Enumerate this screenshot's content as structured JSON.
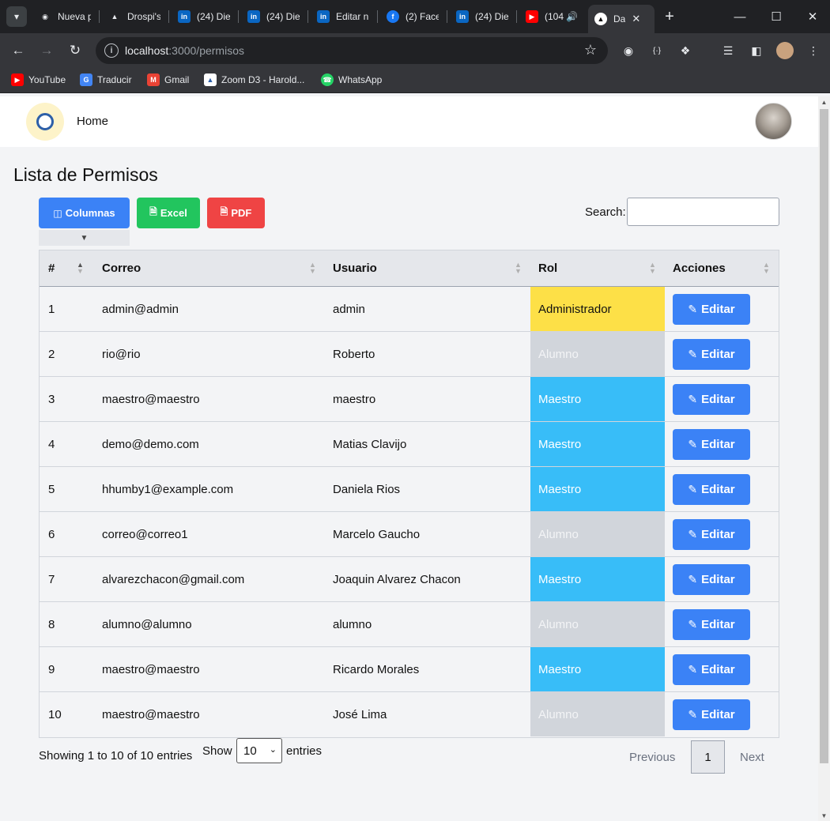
{
  "browser": {
    "tabs": [
      {
        "title": "Nueva p",
        "icon": "chrome-icon",
        "color": "#e8eaed"
      },
      {
        "title": "Drospi's",
        "icon": "vercel-icon",
        "color": "#e8eaed"
      },
      {
        "title": "(24) Die",
        "icon": "linkedin-icon",
        "color": "#0a66c2"
      },
      {
        "title": "(24) Die",
        "icon": "linkedin-icon",
        "color": "#0a66c2"
      },
      {
        "title": "Editar n",
        "icon": "linkedin-icon",
        "color": "#0a66c2"
      },
      {
        "title": "(2) Face",
        "icon": "facebook-icon",
        "color": "#1877f2"
      },
      {
        "title": "(24) Die",
        "icon": "linkedin-icon",
        "color": "#0a66c2"
      },
      {
        "title": "(104",
        "icon": "youtube-icon",
        "color": "#ff0000"
      }
    ],
    "active_tab": {
      "title": "Da",
      "icon": "nextjs-icon"
    },
    "url_host": "localhost",
    "url_path": ":3000/permisos",
    "bookmarks": [
      {
        "label": "YouTube",
        "icon": "youtube-icon",
        "color": "#ff0000"
      },
      {
        "label": "Traducir",
        "icon": "google-translate-icon",
        "color": "#4285f4"
      },
      {
        "label": "Gmail",
        "icon": "gmail-icon",
        "color": "#ea4335"
      },
      {
        "label": "Zoom D3 - Harold...",
        "icon": "page-icon",
        "color": "#ffffff"
      },
      {
        "label": "WhatsApp",
        "icon": "whatsapp-icon",
        "color": "#25d366"
      }
    ]
  },
  "nav": {
    "home_label": "Home"
  },
  "page": {
    "title": "Lista de Permisos",
    "buttons": {
      "columns": "Columnas",
      "excel": "Excel",
      "pdf": "PDF"
    },
    "search_label": "Search:",
    "search_value": ""
  },
  "table": {
    "headers": [
      "#",
      "Correo",
      "Usuario",
      "Rol",
      "Acciones"
    ],
    "edit_label": "Editar",
    "rows": [
      {
        "id": "1",
        "correo": "admin@admin",
        "usuario": "admin",
        "rol": "Administrador",
        "rol_type": "admin"
      },
      {
        "id": "2",
        "correo": "rio@rio",
        "usuario": "Roberto",
        "rol": "Alumno",
        "rol_type": "alumno"
      },
      {
        "id": "3",
        "correo": "maestro@maestro",
        "usuario": "maestro",
        "rol": "Maestro",
        "rol_type": "maestro"
      },
      {
        "id": "4",
        "correo": "demo@demo.com",
        "usuario": "Matias Clavijo",
        "rol": "Maestro",
        "rol_type": "maestro"
      },
      {
        "id": "5",
        "correo": "hhumby1@example.com",
        "usuario": "Daniela Rios",
        "rol": "Maestro",
        "rol_type": "maestro"
      },
      {
        "id": "6",
        "correo": "correo@correo1",
        "usuario": "Marcelo Gaucho",
        "rol": "Alumno",
        "rol_type": "alumno"
      },
      {
        "id": "7",
        "correo": "alvarezchacon@gmail.com",
        "usuario": "Joaquin Alvarez Chacon",
        "rol": "Maestro",
        "rol_type": "maestro"
      },
      {
        "id": "8",
        "correo": "alumno@alumno",
        "usuario": "alumno",
        "rol": "Alumno",
        "rol_type": "alumno"
      },
      {
        "id": "9",
        "correo": "maestro@maestro",
        "usuario": "Ricardo Morales",
        "rol": "Maestro",
        "rol_type": "maestro"
      },
      {
        "id": "10",
        "correo": "maestro@maestro",
        "usuario": "José Lima",
        "rol": "Alumno",
        "rol_type": "alumno"
      }
    ]
  },
  "footer": {
    "info": "Showing 1 to 10 of 10 entries",
    "show_label": "Show",
    "page_length": "10",
    "entries_label": "entries",
    "previous": "Previous",
    "current_page": "1",
    "next": "Next"
  },
  "colors": {
    "primary": "#3b82f6",
    "excel": "#22c55e",
    "pdf": "#ef4444",
    "rol_admin": "#fde047",
    "rol_alumno": "#d1d5db",
    "rol_maestro": "#38bdf8"
  }
}
